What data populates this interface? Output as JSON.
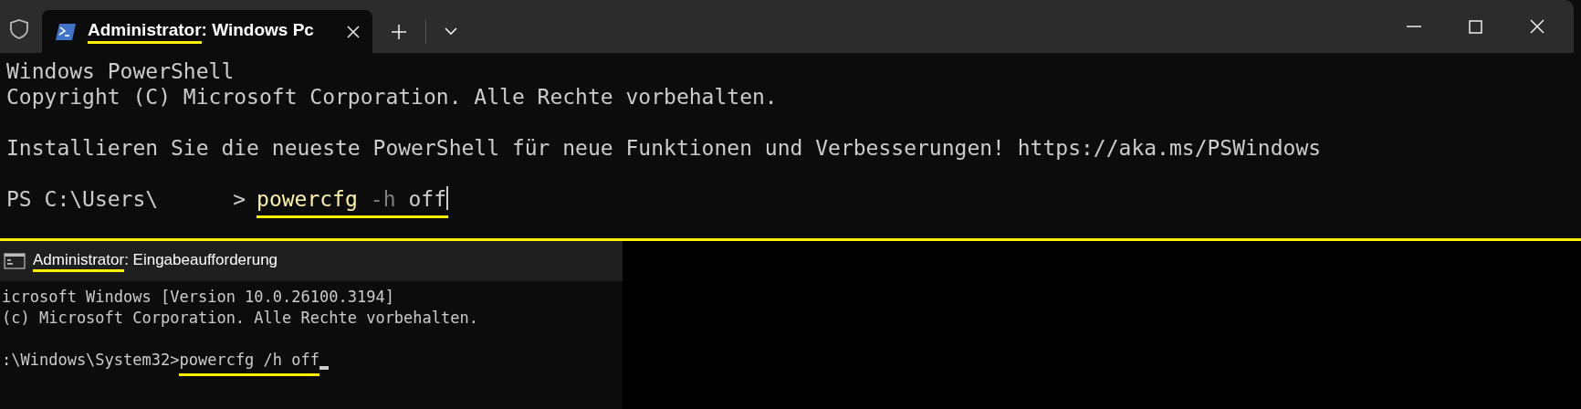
{
  "terminal_window": {
    "tab": {
      "selected": true,
      "title": [
        {
          "text": "Administrator",
          "underlined": true
        },
        {
          "text": ": Windows Pc",
          "underlined": false
        }
      ]
    },
    "paragraphs": [
      [
        "Windows PowerShell",
        "Copyright (C) Microsoft Corporation. Alle Rechte vorbehalten."
      ],
      [
        "Installieren Sie die neueste PowerShell für neue Funktionen und Verbesserungen! https://aka.ms/PSWindows"
      ]
    ],
    "prompt": {
      "prefix": "PS C:\\Users\\",
      "suffix": ">",
      "underlined": true,
      "tokens": [
        {
          "text": "powercfg",
          "kind": "command"
        },
        {
          "text": "-h",
          "kind": "parameter"
        },
        {
          "text": "off",
          "kind": "argument"
        }
      ]
    }
  },
  "cmd_window": {
    "title": [
      {
        "text": "Administrator",
        "underlined": true
      },
      {
        "text": ": Eingabeaufforderung",
        "underlined": false
      }
    ],
    "paragraphs": [
      [
        "icrosoft Windows [Version 10.0.26100.3194]",
        "(c) Microsoft Corporation. Alle Rechte vorbehalten."
      ]
    ],
    "prompt": {
      "prefix": ":\\Windows\\System32>",
      "command": "powercfg /h off",
      "underlined": true
    }
  }
}
